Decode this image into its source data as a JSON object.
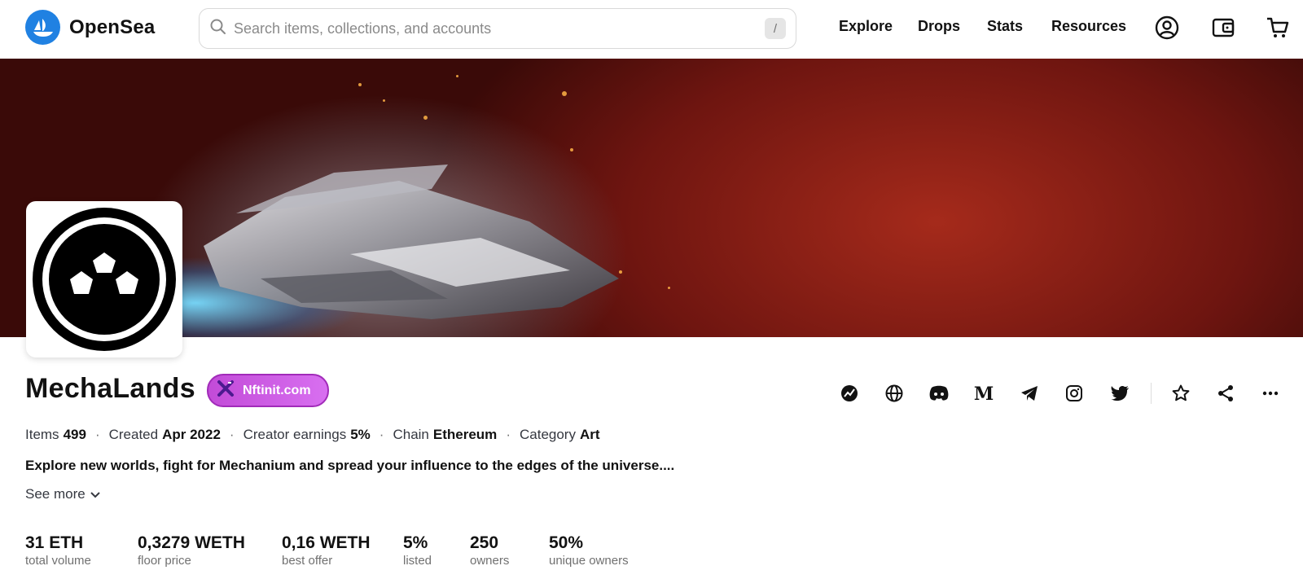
{
  "header": {
    "logo_text": "OpenSea",
    "search_placeholder": "Search items, collections, and accounts",
    "search_shortcut": "/",
    "nav": [
      "Explore",
      "Drops",
      "Stats",
      "Resources"
    ],
    "icons": [
      "account-icon",
      "wallet-icon",
      "cart-icon"
    ]
  },
  "collection": {
    "name": "MechaLands",
    "badge_label": "Nftinit.com",
    "meta": {
      "items_label": "Items",
      "items_value": "499",
      "created_label": "Created",
      "created_value": "Apr 2022",
      "earnings_label": "Creator earnings",
      "earnings_value": "5%",
      "chain_label": "Chain",
      "chain_value": "Ethereum",
      "category_label": "Category",
      "category_value": "Art"
    },
    "description": "Explore new worlds, fight for Mechanium and spread your influence to the edges of the universe....",
    "see_more": "See more",
    "social_icons": [
      "activity-icon",
      "globe-icon",
      "discord-icon",
      "medium-icon",
      "telegram-icon",
      "instagram-icon",
      "twitter-icon",
      "star-icon",
      "share-icon",
      "more-icon"
    ],
    "stats": [
      {
        "value": "31 ETH",
        "label": "total volume"
      },
      {
        "value": "0,3279 WETH",
        "label": "floor price"
      },
      {
        "value": "0,16 WETH",
        "label": "best offer"
      },
      {
        "value": "5%",
        "label": "listed"
      },
      {
        "value": "250",
        "label": "owners"
      },
      {
        "value": "50%",
        "label": "unique owners"
      }
    ]
  },
  "colors": {
    "brand": "#2081e2",
    "badge": "#c24bd8"
  }
}
